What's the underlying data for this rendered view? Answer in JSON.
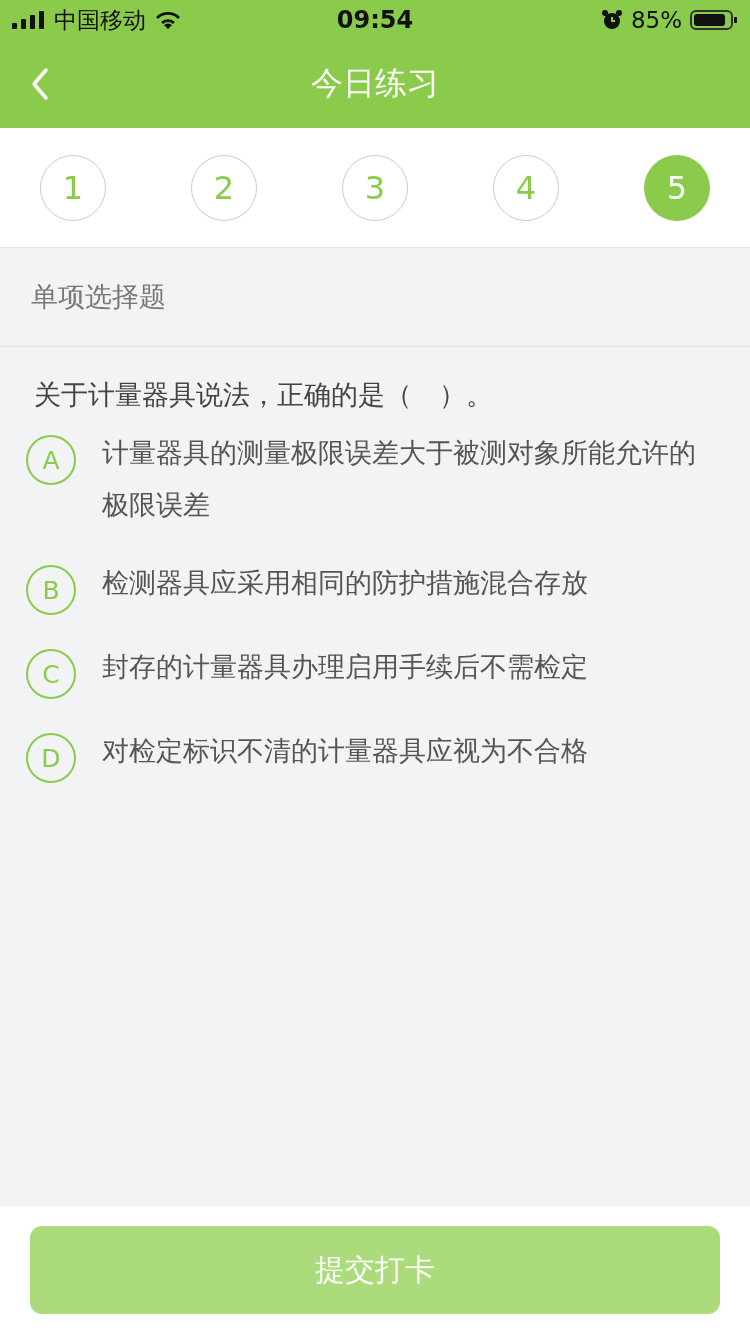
{
  "status_bar": {
    "carrier": "中国移动",
    "time": "09:54",
    "battery": "85%"
  },
  "nav": {
    "title": "今日练习"
  },
  "steps": [
    {
      "label": "1",
      "selected": false
    },
    {
      "label": "2",
      "selected": false
    },
    {
      "label": "3",
      "selected": false
    },
    {
      "label": "4",
      "selected": false
    },
    {
      "label": "5",
      "selected": true
    }
  ],
  "question_type": "单项选择题",
  "question": "关于计量器具说法，正确的是（　）。",
  "options": [
    {
      "letter": "A",
      "text": "计量器具的测量极限误差大于被测对象所能允许的极限误差",
      "selected": false
    },
    {
      "letter": "B",
      "text": "检测器具应采用相同的防护措施混合存放",
      "selected": false
    },
    {
      "letter": "C",
      "text": "封存的计量器具办理启用手续后不需检定",
      "selected": false
    },
    {
      "letter": "D",
      "text": "对检定标识不清的计量器具应视为不合格",
      "selected": false
    }
  ],
  "submit": {
    "label": "提交打卡",
    "disabled": true
  }
}
